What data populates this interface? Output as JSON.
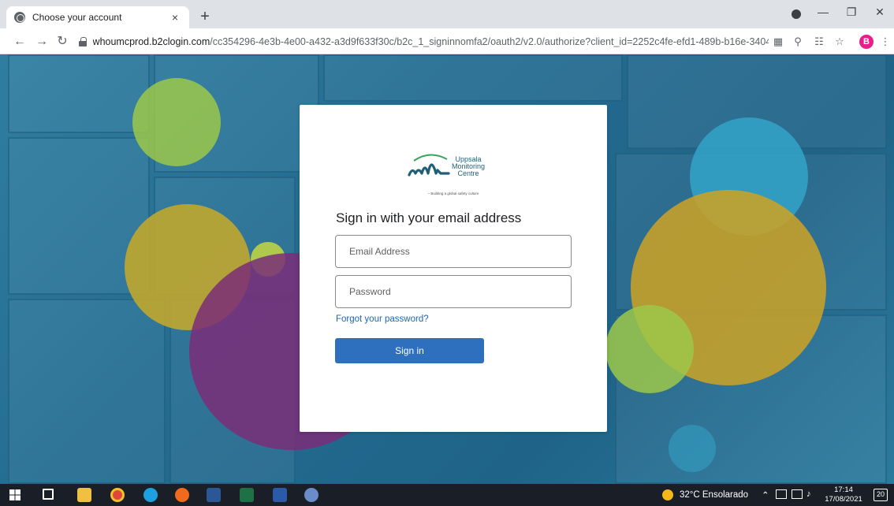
{
  "browser": {
    "tab_title": "Choose your account",
    "tab_close": "×",
    "new_tab": "+",
    "url_host": "whoumcprod.b2clogin.com",
    "url_path": "/cc354296-4e3b-4e00-a432-a3d9f633f30c/b2c_1_signinnomfa2/oauth2/v2.0/authorize?client_id=2252c4fe-efd1-489b-b16e-3404ca51...",
    "profile_initial": "B"
  },
  "logo": {
    "line1": "Uppsala",
    "line2": "Monitoring",
    "line3": "Centre",
    "tagline": "– Building a global safety culture"
  },
  "signin": {
    "heading": "Sign in with your email address",
    "email_placeholder": "Email Address",
    "password_placeholder": "Password",
    "forgot_link": "Forgot your password?",
    "submit_label": "Sign in"
  },
  "taskbar": {
    "weather": "32°C  Ensolarado",
    "time": "17:14",
    "date": "17/08/2021",
    "notification_count": "20"
  },
  "colors": {
    "primary_button": "#2e6fbe",
    "link": "#1b66b5",
    "background_blue": "#246d92",
    "bubble_green": "#9cc84a",
    "bubble_yellow": "#c9a227",
    "bubble_purple": "#7a2d78",
    "bubble_cyan": "#33a4c8"
  }
}
